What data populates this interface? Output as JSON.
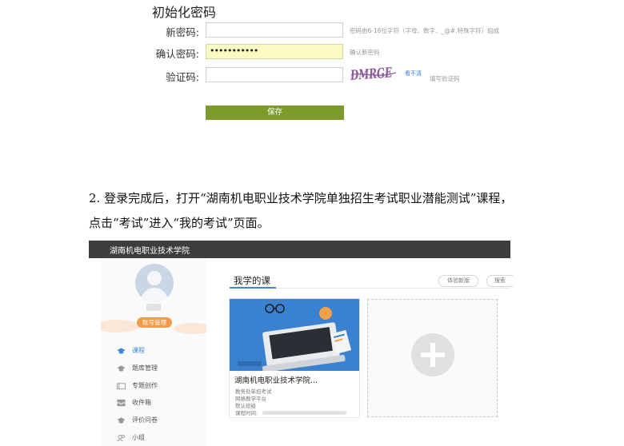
{
  "form": {
    "title": "初始化密码",
    "new_password": {
      "label": "新密码:",
      "value": "",
      "hint": "密码由6-16位字符（字母、数字、_@#.特殊字符）组成"
    },
    "confirm_password": {
      "label": "确认密码:",
      "value": "•••••••••••",
      "hint": "确认新密码"
    },
    "captcha": {
      "label": "验证码:",
      "value": "",
      "image_text": "DMRGE",
      "refresh_text": "看不清",
      "hint": "填写验证码"
    },
    "save_label": "保存",
    "colors": {
      "save_button": "#7d9a2c",
      "autofill": "#fafac3",
      "link": "#2f7fcf"
    }
  },
  "paragraph": {
    "line1": "2. 登录完成后，打开“湖南机电职业技术学院单独招生考试职业潜能测试”课程，",
    "line2": "点击“考试”进入“我的考试”页面。"
  },
  "course_page": {
    "school_name": "湖南机电职业技术学院",
    "account_button": "账号管理",
    "nav": [
      {
        "label": "课程",
        "icon": "graduation-cap-icon",
        "active": true
      },
      {
        "label": "题库管理",
        "icon": "graduation-cap-icon",
        "active": false
      },
      {
        "label": "专题创作",
        "icon": "folder-icon",
        "active": false
      },
      {
        "label": "收件箱",
        "icon": "inbox-icon",
        "active": false
      },
      {
        "label": "评价问卷",
        "icon": "graduation-cap-icon",
        "active": false
      },
      {
        "label": "小组",
        "icon": "group-icon",
        "active": false
      }
    ],
    "section_title": "我学的课",
    "try_new_version": "体验新版",
    "search": "搜索",
    "course_card": {
      "title": "湖南机电职业技术学院...",
      "lines": [
        "教务处单招考试",
        "网络教学平台",
        "默认班级",
        "课程时间:"
      ]
    },
    "colors": {
      "topbar": "#3d3d3d",
      "accent": "#3b8ad9",
      "account_button": "#f09a4a",
      "card_image": "#3a82cf"
    }
  }
}
